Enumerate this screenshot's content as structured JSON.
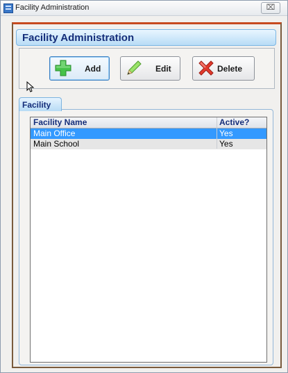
{
  "window": {
    "title": "Facility Administration",
    "close_label": "⌧"
  },
  "panel": {
    "title": "Facility Administration"
  },
  "toolbar": {
    "add_label": "Add",
    "edit_label": "Edit",
    "delete_label": "Delete"
  },
  "tabs": [
    {
      "label": "Facility"
    }
  ],
  "table": {
    "columns": [
      "Facility Name",
      "Active?"
    ],
    "rows": [
      {
        "name": "Main Office",
        "active": "Yes",
        "selected": true
      },
      {
        "name": "Main School",
        "active": "Yes",
        "selected": false
      }
    ]
  },
  "icons": {
    "add": "plus-icon",
    "edit": "pencil-icon",
    "delete": "x-icon",
    "app": "app-icon"
  },
  "colors": {
    "accent": "#152e7a",
    "selection": "#3399ff",
    "tab_fill": "#b7dbf5",
    "frame_border": "#c74a1f"
  }
}
